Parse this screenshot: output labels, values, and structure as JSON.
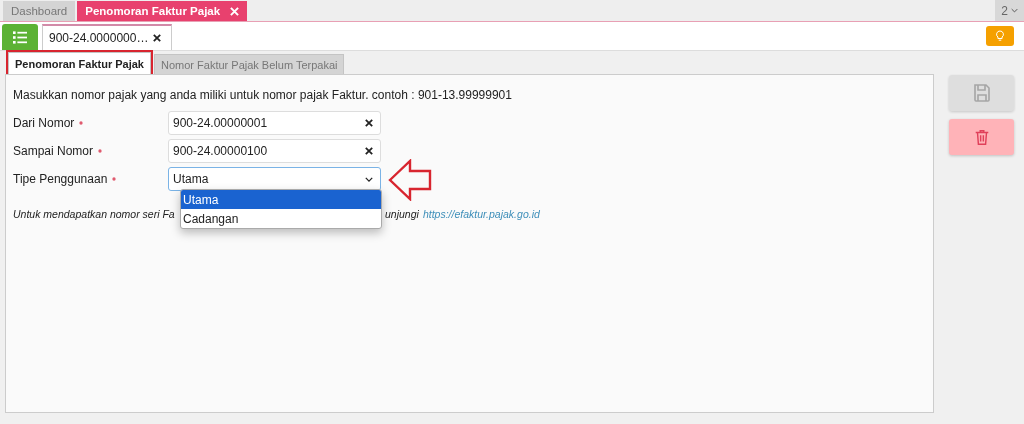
{
  "top_tabs": [
    {
      "label": "Dashboard",
      "selected": false,
      "closable": false
    },
    {
      "label": "Penomoran Faktur Pajak",
      "selected": true,
      "closable": true
    }
  ],
  "tab_count": "2",
  "doc_tabs": [
    {
      "label": "900-24.0000000…",
      "selected": true
    }
  ],
  "inner_tabs": [
    {
      "label": "Penomoran Faktur Pajak",
      "selected": true,
      "highlighted": true
    },
    {
      "label": "Nomor Faktur Pajak Belum Terpakai",
      "selected": false,
      "highlighted": false
    }
  ],
  "instruction": "Masukkan nomor pajak yang anda miliki untuk nomor pajak Faktur. contoh : 901-13.99999901",
  "fields": [
    {
      "kind": "text",
      "label": "Dari Nomor",
      "required": true,
      "value": "900-24.00000001"
    },
    {
      "kind": "text",
      "label": "Sampai Nomor",
      "required": true,
      "value": "900-24.00000100"
    },
    {
      "kind": "select",
      "label": "Tipe Penggunaan",
      "required": true,
      "value": "Utama",
      "expanded": true,
      "options": [
        {
          "label": "Utama",
          "selected": true
        },
        {
          "label": "Cadangan",
          "selected": false
        }
      ]
    }
  ],
  "hint": {
    "before": "Untuk mendapatkan nomor seri Fa",
    "after": "unjungi",
    "link": "https://efaktur.pajak.go.id"
  },
  "actions": [
    {
      "kind": "save",
      "disabled": true
    },
    {
      "kind": "delete",
      "disabled": false
    }
  ]
}
